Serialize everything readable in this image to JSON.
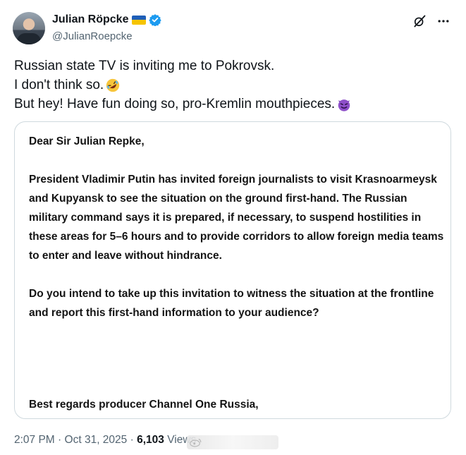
{
  "author": {
    "name": "Julian Röpcke",
    "handle": "@JulianRoepcke"
  },
  "tweet": {
    "lines": [
      "Russian state TV is inviting me to Pokrovsk.",
      "I don't think so.",
      "But hey! Have fun doing so, pro-Kremlin mouthpieces."
    ],
    "emoji_1": "rolling-on-floor-laughing",
    "emoji_2": "smiling-face-with-horns"
  },
  "attachment": {
    "greeting": "Dear Sir Julian Repke,",
    "paragraph_1": "President Vladimir Putin has invited foreign journalists to visit Krasnoarmeysk and Kupyansk to see the situation on the ground first-hand. The Russian military command says it is prepared, if necessary, to suspend hostilities in these areas for 5–6 hours and to provide corridors to allow foreign media teams to enter and leave without hindrance.",
    "paragraph_2": "Do you intend to take up this invitation to witness the situation at the frontline and report this first-hand information to your audience?",
    "closing": "Best regards producer Channel One Russia,"
  },
  "meta": {
    "time": "2:07 PM",
    "separator": "·",
    "date": "Oct 31, 2025",
    "views_count": "6,103",
    "views_label": "Views"
  },
  "icons": {
    "grok": "grok-icon",
    "more": "more-icon",
    "verified_color": "#1d9bf0"
  }
}
